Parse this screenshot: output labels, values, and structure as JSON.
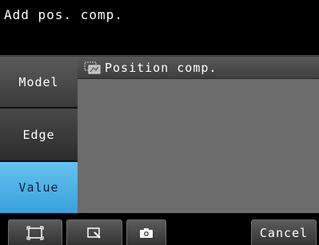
{
  "header": {
    "title": "Add pos. comp."
  },
  "tabs": [
    {
      "label": "Model",
      "selected": false
    },
    {
      "label": "Edge",
      "selected": false
    },
    {
      "label": "Value",
      "selected": true
    }
  ],
  "panel": {
    "title": "Position comp.",
    "icon": "position-comp-icon"
  },
  "toolbar": {
    "buttons": [
      {
        "icon": "frame-icon"
      },
      {
        "icon": "zoom-icon"
      },
      {
        "icon": "camera-icon"
      }
    ],
    "cancel_label": "Cancel"
  },
  "colors": {
    "selected_tab": "#4fb3ea",
    "panel_bg": "#6c6c6c",
    "background": "#000000"
  }
}
